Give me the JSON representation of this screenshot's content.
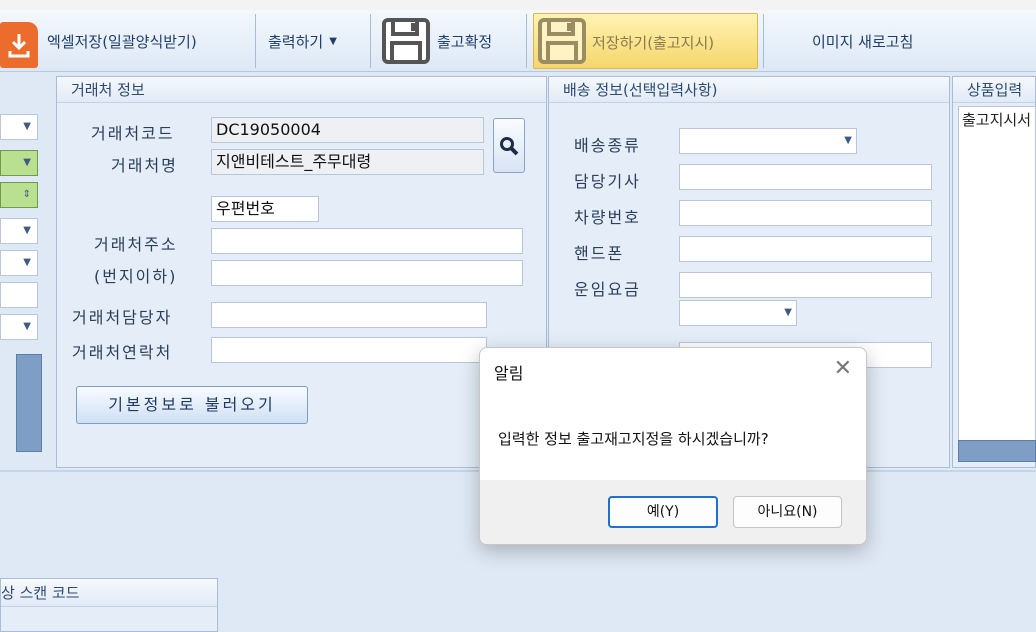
{
  "toolbar": {
    "excel_save": "엑셀저장(일괄양식받기)",
    "print": "출력하기",
    "confirm_release": "출고확정",
    "save_release": "저장하기(출고지시)",
    "refresh_image": "이미지 새로고침"
  },
  "client_panel": {
    "title": "거래처 정보",
    "code_label": "거래처코드",
    "code_value": "DC19050004",
    "name_label": "거래처명",
    "name_value": "지앤비테스트_주무대령",
    "zip_value": "우편번호",
    "address_label": "거래처주소",
    "address_sub_label": "(번지이하)",
    "manager_label": "거래처담당자",
    "contact_label": "거래처연락처",
    "load_basic_button": "기본정보로 불러오기"
  },
  "delivery_panel": {
    "title": "배송 정보(선택입력사항)",
    "type_label": "배송종류",
    "driver_label": "담당기사",
    "vehicle_label": "차량번호",
    "phone_label": "핸드폰",
    "fee_label": "운임요금"
  },
  "product_panel": {
    "title": "상품입력",
    "text_value": "출고지시서"
  },
  "scan_panel": {
    "title": "상 스캔 코드"
  },
  "dialog": {
    "title": "알림",
    "close_glyph": "✕",
    "message": "입력한 정보 출고재고지정을 하시겠습니까?",
    "yes_button": "예(Y)",
    "no_button": "아니요(N)"
  },
  "colors": {
    "accent": "#1f6fd1",
    "excel": "#ec6c2d",
    "highlight": "#f5d66b"
  }
}
